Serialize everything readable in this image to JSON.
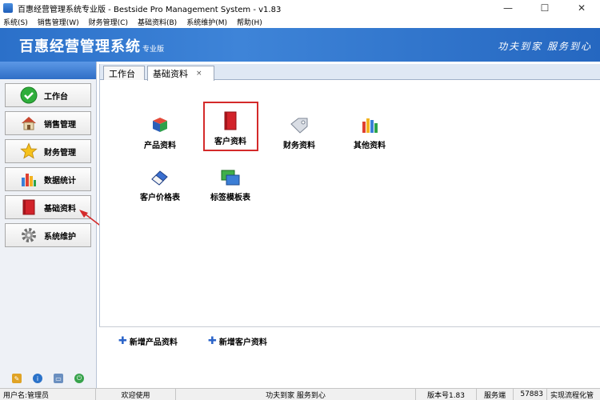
{
  "window": {
    "title": "百惠经营管理系统专业版 - Bestside Pro Management System - v1.83",
    "minimize": "—",
    "maximize": "☐",
    "close": "✕"
  },
  "menu": [
    "系统(S)",
    "销售管理(W)",
    "财务管理(C)",
    "基础资料(B)",
    "系统维护(M)",
    "帮助(H)"
  ],
  "banner": {
    "title": "百惠经营管理系统",
    "edition": "专业版",
    "slogan": "功夫到家 服务到心"
  },
  "sidebar": {
    "items": [
      {
        "label": "工作台",
        "icon": "check-circle-icon"
      },
      {
        "label": "销售管理",
        "icon": "house-icon"
      },
      {
        "label": "财务管理",
        "icon": "star-icon"
      },
      {
        "label": "数据统计",
        "icon": "bar-chart-icon"
      },
      {
        "label": "基础资料",
        "icon": "red-book-icon"
      },
      {
        "label": "系统维护",
        "icon": "gear-icon"
      }
    ],
    "footer_icons": [
      "edit-icon",
      "info-icon",
      "window-icon",
      "power-icon"
    ]
  },
  "tabs": [
    {
      "label": "工作台"
    },
    {
      "label": "基础资料",
      "close": "×"
    }
  ],
  "modules": [
    {
      "label": "产品资料",
      "icon": "cubes-icon"
    },
    {
      "label": "客户资料",
      "icon": "red-book-icon"
    },
    {
      "label": "财务资料",
      "icon": "tag-icon"
    },
    {
      "label": "其他资料",
      "icon": "palette-icon"
    },
    {
      "label": "客户价格表",
      "icon": "eraser-icon"
    },
    {
      "label": "标签模板表",
      "icon": "windows-icon"
    }
  ],
  "quick_links": [
    "新增产品资料",
    "新增客户资料"
  ],
  "status": {
    "user": "用户名:管理员",
    "welcome": "欢迎使用",
    "slogan": "功夫到家 服务到心",
    "version": "版本号1.83",
    "server": "服务端",
    "port": "57883",
    "flow": "实现流程化管"
  },
  "colors": {
    "banner": "#2b70c9",
    "highlight": "#d42a2a",
    "accent_plus": "#2a63c9"
  }
}
